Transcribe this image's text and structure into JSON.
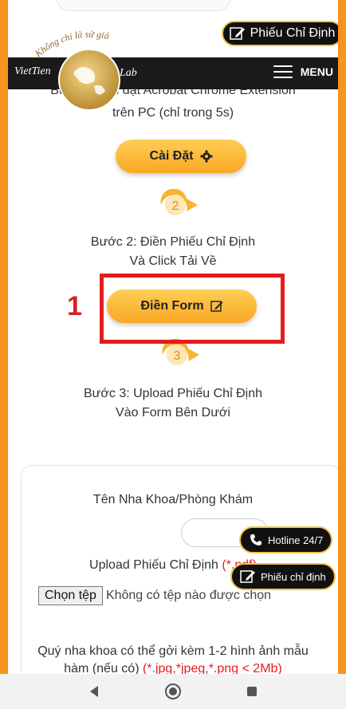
{
  "header": {
    "top_button_label": "Phiếu Chỉ Định",
    "menu_label": "MENU",
    "logo": {
      "tagline": "Không chỉ là sứ giả",
      "left": "VietTien",
      "right": "Lab"
    }
  },
  "steps": {
    "step1_text_line1": "Bước 1: Cài đặt Acrobat Chrome Extension",
    "step1_text_line2": "trên PC (chỉ trong 5s)",
    "install_button": "Cài Đặt",
    "step2_number": "2",
    "step2_line1": "Bước 2: Điền Phiếu Chỉ Định",
    "step2_line2": "Và Click Tải Về",
    "fill_button": "Điền Form",
    "annotation_number": "1",
    "step3_number": "3",
    "step3_line1": "Bước 3: Upload Phiếu Chỉ Định",
    "step3_line2": "Vào Form Bên Dưới"
  },
  "form": {
    "clinic_label": "Tên Nha Khoa/Phòng Khám",
    "upload_label": "Upload Phiếu Chỉ Định",
    "upload_req": "(*.pdf)",
    "choose_file": "Chọn tệp",
    "no_file": "Không có tệp nào được chọn",
    "attach_line1": "Quý nha khoa có thể gởi kèm 1-2 hình ảnh mẫu",
    "attach_line2": "hàm (nếu có)",
    "attach_req": "(*.jpg,*jpeg,*.png < 2Mb)"
  },
  "floating": {
    "hotline_label": "Hotline 24/7",
    "form_label": "Phiếu chỉ định"
  },
  "colors": {
    "accent": "#f7941d",
    "button": "#f9a825",
    "highlight": "#e41c1c"
  },
  "icons": [
    "edit-icon",
    "gear-icon",
    "phone-icon",
    "menu-icon",
    "back-icon",
    "home-icon",
    "recents-icon"
  ]
}
